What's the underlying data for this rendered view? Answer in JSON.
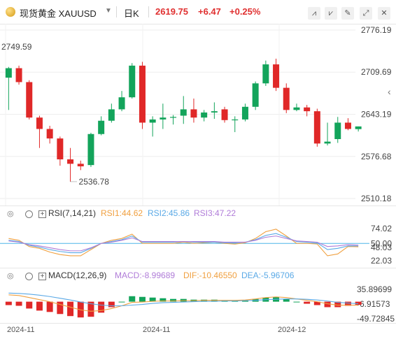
{
  "header": {
    "title": "现货黄金",
    "symbol": "XAUUSD",
    "period": "日K",
    "price": "2619.75",
    "change": "+6.47",
    "change_pct": "+0.25%"
  },
  "colors": {
    "up": "#e02828",
    "down": "#13a45b",
    "rsi1": "#f0a040",
    "rsi2": "#5aa9e6",
    "rsi3": "#b07cd8",
    "dif": "#f0a040",
    "dea": "#5aa9e6",
    "baseline": "#4db6e8"
  },
  "toolbar": {
    "icons": [
      "draw-line-icon",
      "draw-ray-icon",
      "pen-icon",
      "eraser-icon",
      "expand-icon",
      "settings-icon"
    ]
  },
  "main_axis": {
    "labels": [
      "2776.19",
      "2709.69",
      "2643.19",
      "2576.68",
      "2510.18"
    ]
  },
  "annotations": {
    "high": "2749.59",
    "low": "2536.78"
  },
  "rsi": {
    "name": "RSI(7,14,21)",
    "rsi1": "RSI1:44.62",
    "rsi2": "RSI2:45.86",
    "rsi3": "RSI3:47.22",
    "axis": [
      "74.02",
      "50.00",
      "48.03",
      "22.03"
    ]
  },
  "macd": {
    "name": "MACD(12,26,9)",
    "macd": "MACD:-8.99689",
    "dif": "DIF:-10.46550",
    "dea": "DEA:-5.96706",
    "axis": [
      "35.89699",
      "-6.91573",
      "-49.72845"
    ]
  },
  "x_axis": {
    "labels": [
      "2024-11",
      "2024-11",
      "2024-12"
    ]
  },
  "chart_data": {
    "type": "candlestick",
    "title": "现货黄金 XAUUSD 日K",
    "ylim": [
      2510.18,
      2776.19
    ],
    "candles": [
      {
        "o": 2701,
        "h": 2718,
        "l": 2650,
        "c": 2716
      },
      {
        "o": 2716,
        "h": 2720,
        "l": 2690,
        "c": 2694
      },
      {
        "o": 2694,
        "h": 2697,
        "l": 2635,
        "c": 2638
      },
      {
        "o": 2638,
        "h": 2641,
        "l": 2590,
        "c": 2620
      },
      {
        "o": 2620,
        "h": 2625,
        "l": 2597,
        "c": 2605
      },
      {
        "o": 2605,
        "h": 2608,
        "l": 2562,
        "c": 2572
      },
      {
        "o": 2572,
        "h": 2590,
        "l": 2536.78,
        "c": 2565
      },
      {
        "o": 2565,
        "h": 2570,
        "l": 2555,
        "c": 2561
      },
      {
        "o": 2563,
        "h": 2614,
        "l": 2560,
        "c": 2612
      },
      {
        "o": 2612,
        "h": 2640,
        "l": 2610,
        "c": 2633
      },
      {
        "o": 2633,
        "h": 2660,
        "l": 2630,
        "c": 2651
      },
      {
        "o": 2651,
        "h": 2680,
        "l": 2648,
        "c": 2670
      },
      {
        "o": 2670,
        "h": 2724,
        "l": 2668,
        "c": 2720
      },
      {
        "o": 2720,
        "h": 2726,
        "l": 2620,
        "c": 2630
      },
      {
        "o": 2630,
        "h": 2640,
        "l": 2608,
        "c": 2635
      },
      {
        "o": 2635,
        "h": 2660,
        "l": 2620,
        "c": 2638
      },
      {
        "o": 2638,
        "h": 2642,
        "l": 2627,
        "c": 2639
      },
      {
        "o": 2641,
        "h": 2672,
        "l": 2628,
        "c": 2651
      },
      {
        "o": 2651,
        "h": 2668,
        "l": 2630,
        "c": 2638
      },
      {
        "o": 2638,
        "h": 2650,
        "l": 2632,
        "c": 2646
      },
      {
        "o": 2646,
        "h": 2662,
        "l": 2636,
        "c": 2648
      },
      {
        "o": 2651,
        "h": 2655,
        "l": 2630,
        "c": 2634
      },
      {
        "o": 2634,
        "h": 2640,
        "l": 2615,
        "c": 2635
      },
      {
        "o": 2635,
        "h": 2660,
        "l": 2632,
        "c": 2655
      },
      {
        "o": 2655,
        "h": 2695,
        "l": 2650,
        "c": 2692
      },
      {
        "o": 2692,
        "h": 2728,
        "l": 2688,
        "c": 2722
      },
      {
        "o": 2722,
        "h": 2731,
        "l": 2680,
        "c": 2685
      },
      {
        "o": 2685,
        "h": 2692,
        "l": 2645,
        "c": 2650
      },
      {
        "o": 2650,
        "h": 2660,
        "l": 2648,
        "c": 2654
      },
      {
        "o": 2654,
        "h": 2658,
        "l": 2640,
        "c": 2648
      },
      {
        "o": 2648,
        "h": 2652,
        "l": 2592,
        "c": 2597
      },
      {
        "o": 2597,
        "h": 2630,
        "l": 2594,
        "c": 2600
      },
      {
        "o": 2604,
        "h": 2639,
        "l": 2598,
        "c": 2630
      },
      {
        "o": 2630,
        "h": 2637,
        "l": 2618,
        "c": 2620
      },
      {
        "o": 2619.75,
        "h": 2624,
        "l": 2616,
        "c": 2624
      }
    ],
    "rsi": {
      "RSI1": [
        58,
        55,
        45,
        42,
        36,
        32,
        30,
        30,
        40,
        50,
        55,
        58,
        65,
        50,
        50,
        50,
        50,
        52,
        50,
        51,
        52,
        50,
        49,
        51,
        58,
        69,
        73,
        62,
        50,
        50,
        49,
        30,
        33,
        45,
        44.62
      ],
      "RSI2": [
        55,
        53,
        47,
        44,
        40,
        37,
        35,
        35,
        42,
        50,
        53,
        56,
        62,
        52,
        52,
        52,
        52,
        53,
        52,
        52,
        52,
        51,
        51,
        52,
        56,
        63,
        66,
        60,
        53,
        52,
        51,
        40,
        42,
        46,
        45.86
      ],
      "RSI3": [
        54,
        52,
        48,
        46,
        43,
        40,
        38,
        38,
        43,
        50,
        52,
        55,
        59,
        53,
        53,
        53,
        53,
        53,
        53,
        53,
        53,
        52,
        52,
        52,
        55,
        60,
        62,
        58,
        54,
        53,
        52,
        45,
        46,
        48,
        47.22
      ]
    },
    "macd": {
      "DIF": [
        20,
        18,
        12,
        6,
        0,
        -8,
        -16,
        -24,
        -28,
        -26,
        -20,
        -12,
        -2,
        -1,
        1,
        2,
        2,
        3,
        3,
        4,
        4,
        4,
        4,
        5,
        8,
        12,
        14,
        12,
        8,
        4,
        0,
        -6,
        -10,
        -10,
        -10.4655
      ],
      "DEA": [
        25,
        24,
        22,
        19,
        15,
        10,
        5,
        -1,
        -6,
        -10,
        -12,
        -12,
        -10,
        -8,
        -5,
        -3,
        -2,
        -1,
        0,
        1,
        1,
        2,
        2,
        3,
        4,
        6,
        7,
        8,
        8,
        7,
        5,
        2,
        -2,
        -4,
        -5.96706
      ],
      "MACD": [
        -10,
        -12,
        -20,
        -26,
        -30,
        -36,
        -42,
        -46,
        -44,
        -32,
        -16,
        0,
        16,
        14,
        12,
        10,
        8,
        8,
        6,
        6,
        6,
        4,
        4,
        4,
        8,
        12,
        14,
        8,
        0,
        -6,
        -10,
        -16,
        -16,
        -12,
        -8.99689
      ]
    }
  }
}
